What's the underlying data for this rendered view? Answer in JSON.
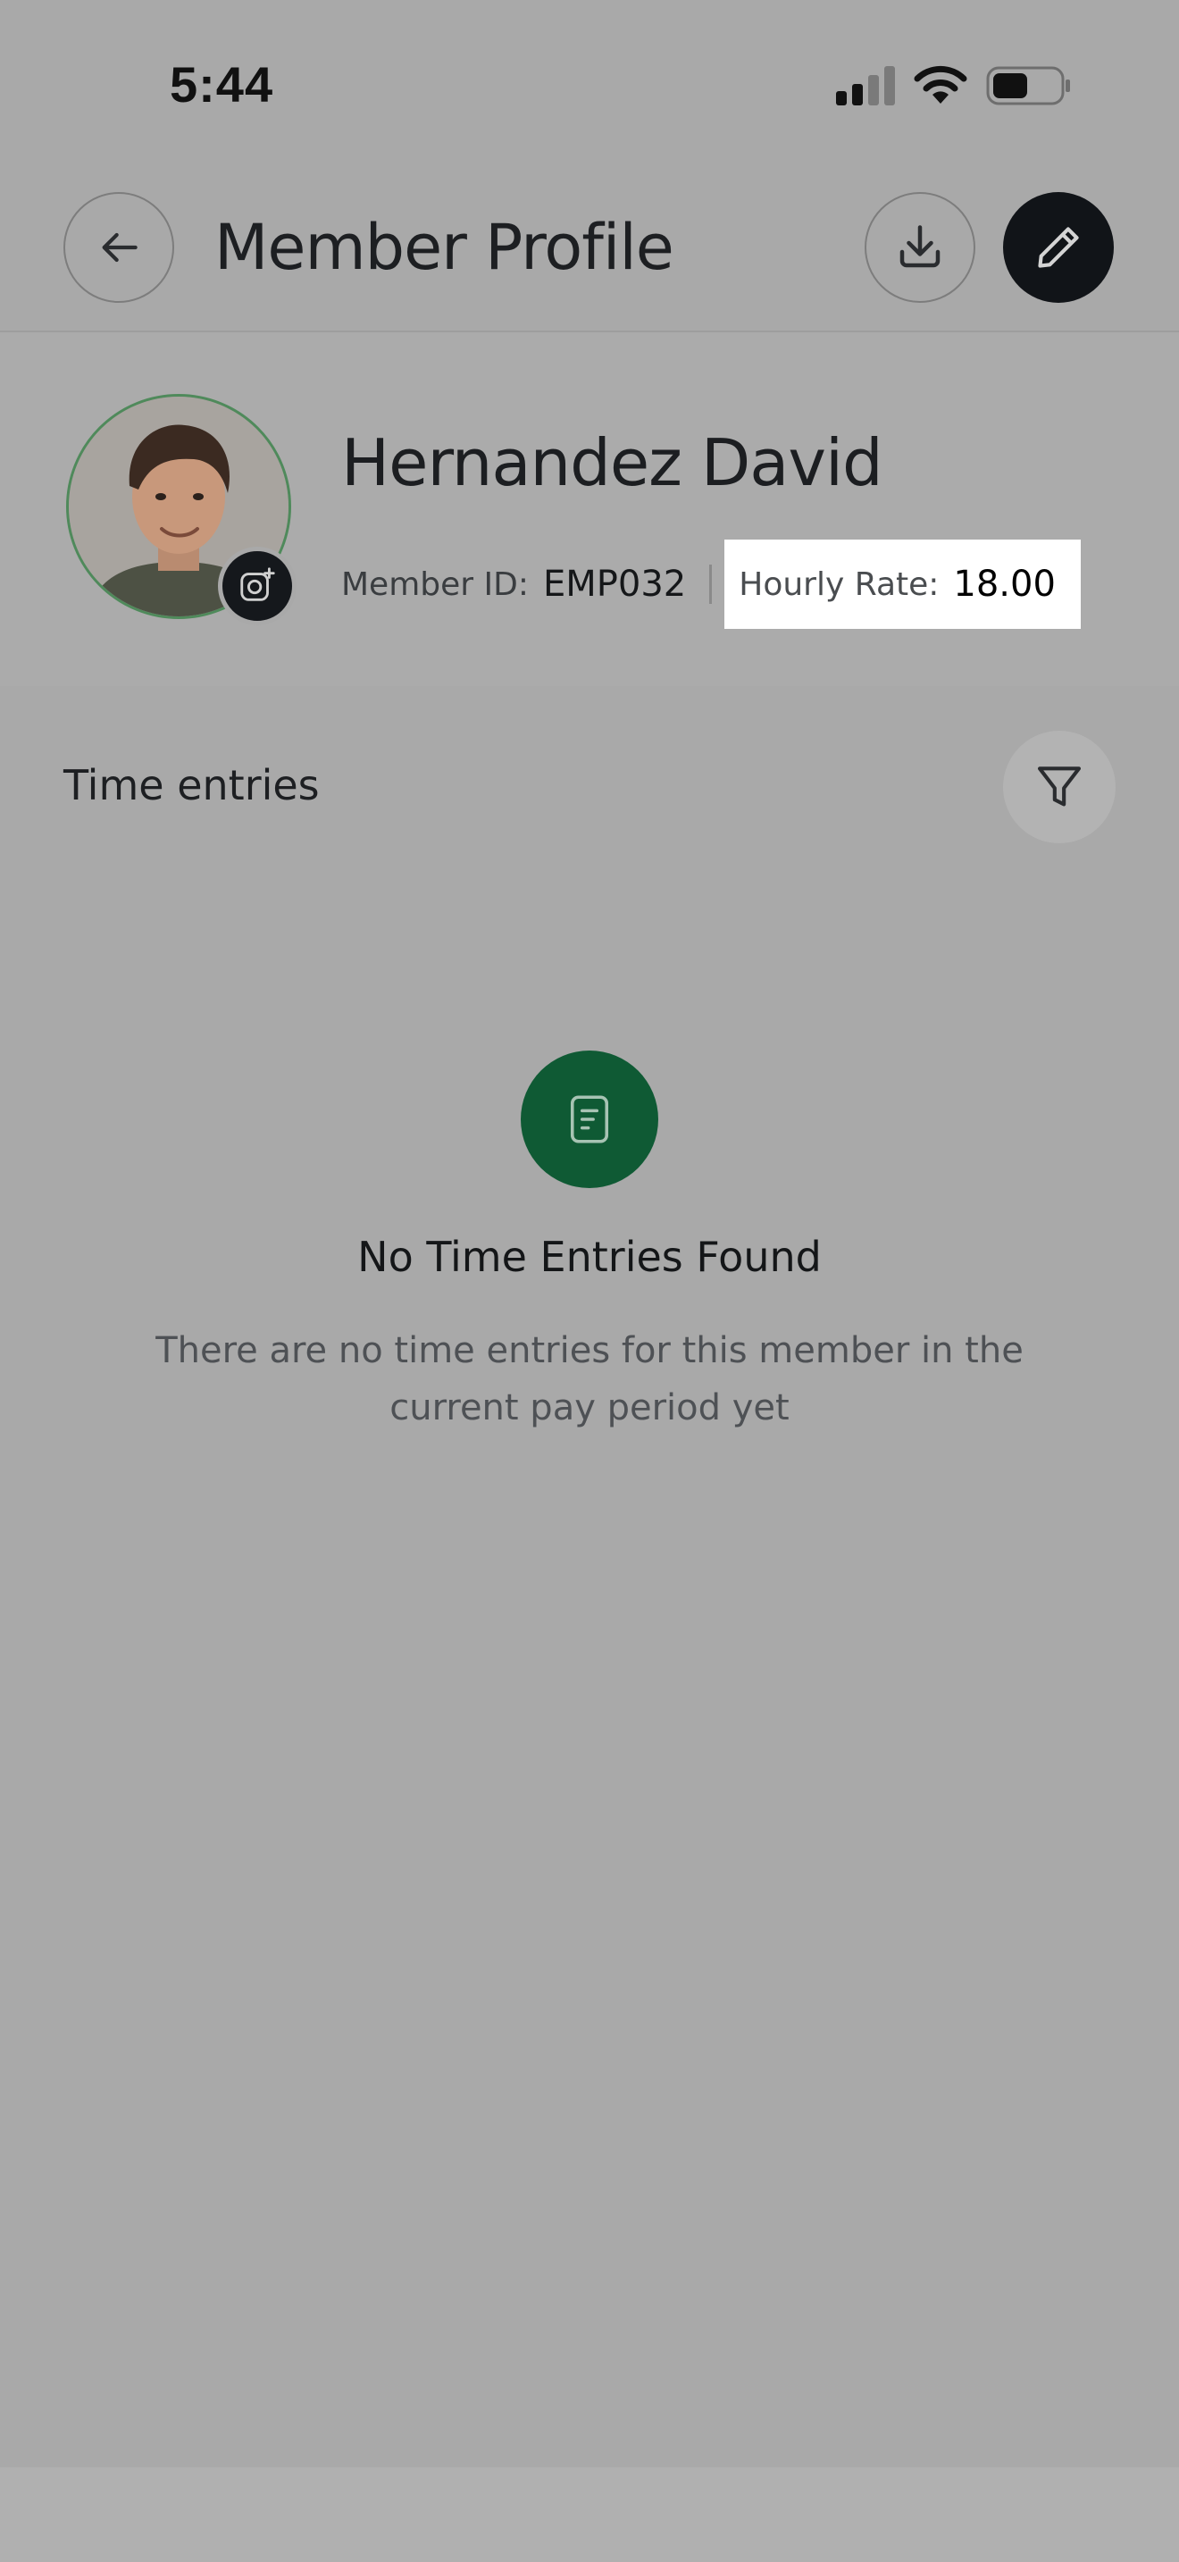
{
  "status_bar": {
    "time": "5:44"
  },
  "header": {
    "title": "Member Profile",
    "icons": {
      "back": "arrow-left-icon",
      "download": "download-icon",
      "edit": "pencil-icon"
    }
  },
  "profile": {
    "name": "Hernandez David",
    "member_id_label": "Member ID:",
    "member_id": "EMP032",
    "hourly_rate_label": "Hourly Rate:",
    "hourly_rate": "18.00",
    "avatar_icon": "avatar-photo",
    "camera_icon": "camera-add-icon"
  },
  "time_entries": {
    "title": "Time entries",
    "filter_icon": "filter-icon",
    "empty_state": {
      "icon": "document-icon",
      "title": "No Time Entries Found",
      "description": "There are no time entries for this member in the current pay period yet"
    }
  },
  "colors": {
    "overlay": "#a9a9a9",
    "accent_green": "#0f5a34",
    "dark_button": "#111418",
    "highlight": "#ffffff"
  }
}
